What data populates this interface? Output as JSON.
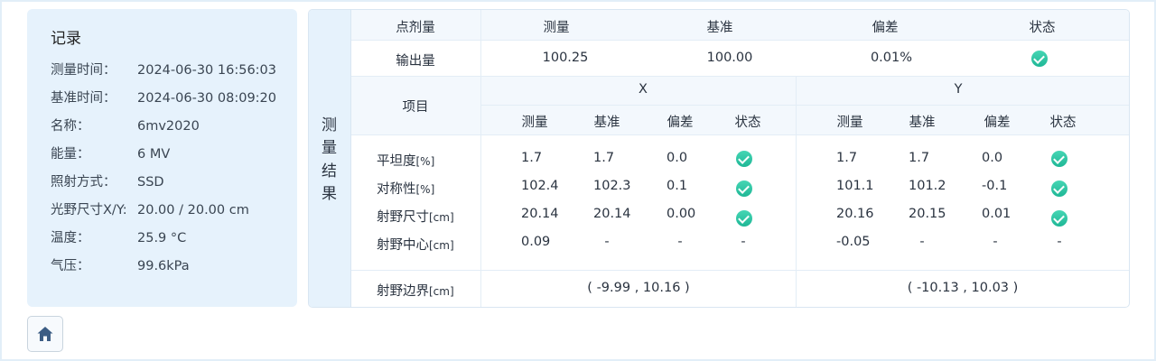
{
  "record": {
    "title": "记录",
    "rows": [
      {
        "label": "测量时间：",
        "value": "2024-06-30  16:56:03"
      },
      {
        "label": "基准时间：",
        "value": "2024-06-30  08:09:20"
      },
      {
        "label": "名称：",
        "value": "6mv2020"
      },
      {
        "label": "能量：",
        "value": "6 MV"
      },
      {
        "label": "照射方式：",
        "value": "SSD"
      },
      {
        "label": "光野尺寸X/Y:",
        "value": "20.00 / 20.00 cm"
      },
      {
        "label": "温度：",
        "value": "25.9 °C"
      },
      {
        "label": "气压：",
        "value": "99.6kPa"
      }
    ]
  },
  "results": {
    "side_chars": [
      "测",
      "量",
      "结",
      "果"
    ],
    "dose": {
      "headers": [
        "点剂量",
        "测量",
        "基准",
        "偏差",
        "状态"
      ],
      "row_label": "输出量",
      "measured": "100.25",
      "reference": "100.00",
      "deviation": "0.01%",
      "status": "ok"
    },
    "profile": {
      "item_header": "项目",
      "x_header": "X",
      "y_header": "Y",
      "sub_headers": [
        "测量",
        "基准",
        "偏差",
        "状态"
      ],
      "rows": [
        {
          "name": "平坦度",
          "unit": "[%]",
          "x": [
            "1.7",
            "1.7",
            "0.0"
          ],
          "x_ok": true,
          "y": [
            "1.7",
            "1.7",
            "0.0"
          ],
          "y_ok": true
        },
        {
          "name": "对称性",
          "unit": "[%]",
          "x": [
            "102.4",
            "102.3",
            "0.1"
          ],
          "x_ok": true,
          "y": [
            "101.1",
            "101.2",
            "-0.1"
          ],
          "y_ok": true
        },
        {
          "name": "射野尺寸",
          "unit": "[cm]",
          "x": [
            "20.14",
            "20.14",
            "0.00"
          ],
          "x_ok": true,
          "y": [
            "20.16",
            "20.15",
            "0.01"
          ],
          "y_ok": true
        },
        {
          "name": "射野中心",
          "unit": "[cm]",
          "x": [
            "0.09",
            "-",
            "-"
          ],
          "x_status": "-",
          "y": [
            "-0.05",
            "-",
            "-"
          ],
          "y_status": "-"
        }
      ],
      "edge": {
        "name": "射野边界",
        "unit": "[cm]",
        "x": "( -9.99 , 10.16 )",
        "y": "( -10.13 , 10.03 )"
      }
    }
  },
  "nav": {
    "home_icon": "home-icon"
  },
  "colors": {
    "panel_bg": "#e6f2fc",
    "status_ok": "#26c09f"
  }
}
